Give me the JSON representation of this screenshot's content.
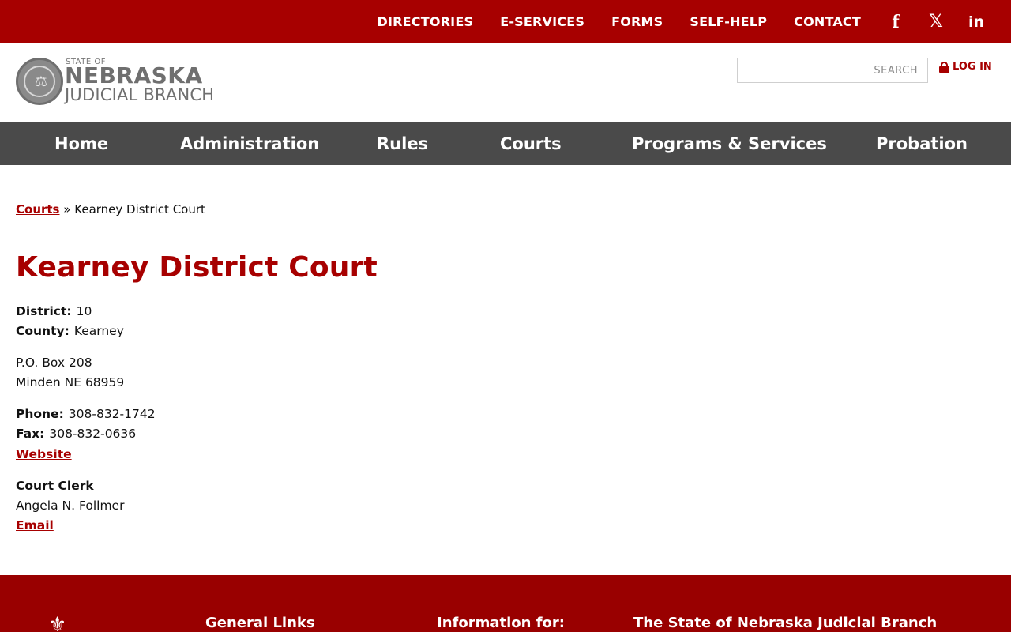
{
  "top_nav": {
    "links": [
      "DIRECTORIES",
      "E-SERVICES",
      "FORMS",
      "SELF-HELP",
      "CONTACT"
    ],
    "social": [
      {
        "icon": "facebook-icon",
        "glyph": "f"
      },
      {
        "icon": "x-twitter-icon",
        "glyph": "𝕏"
      },
      {
        "icon": "linkedin-icon",
        "glyph": "in"
      }
    ]
  },
  "header": {
    "logo": {
      "small": "STATE OF",
      "big": "NEBRASKA",
      "sub": "JUDICIAL BRANCH"
    },
    "search": {
      "placeholder": "SEARCH",
      "value": ""
    },
    "login_label": "LOG IN",
    "login_icon": "lock-icon"
  },
  "main_nav": [
    "Home",
    "Administration",
    "Rules",
    "Courts",
    "Programs & Services",
    "Probation"
  ],
  "breadcrumb": {
    "parent": "Courts",
    "separator": "»",
    "current": "Kearney District Court"
  },
  "court": {
    "title": "Kearney District Court",
    "district_label": "District:",
    "district": "10",
    "county_label": "County:",
    "county": "Kearney",
    "address_line1": "P.O. Box 208",
    "address_line2": "Minden NE 68959",
    "phone_label": "Phone:",
    "phone": "308-832-1742",
    "fax_label": "Fax:",
    "fax": "308-832-0636",
    "website_label": "Website",
    "clerk_title": "Court Clerk",
    "clerk_name": "Angela N. Follmer",
    "email_label": "Email"
  },
  "footer": {
    "columns": [
      "General Links",
      "Information for:",
      "The State of Nebraska Judicial Branch"
    ]
  },
  "colors": {
    "brand_red": "#a70000",
    "footer_red": "#990000",
    "nav_gray": "#4a4a4a"
  }
}
